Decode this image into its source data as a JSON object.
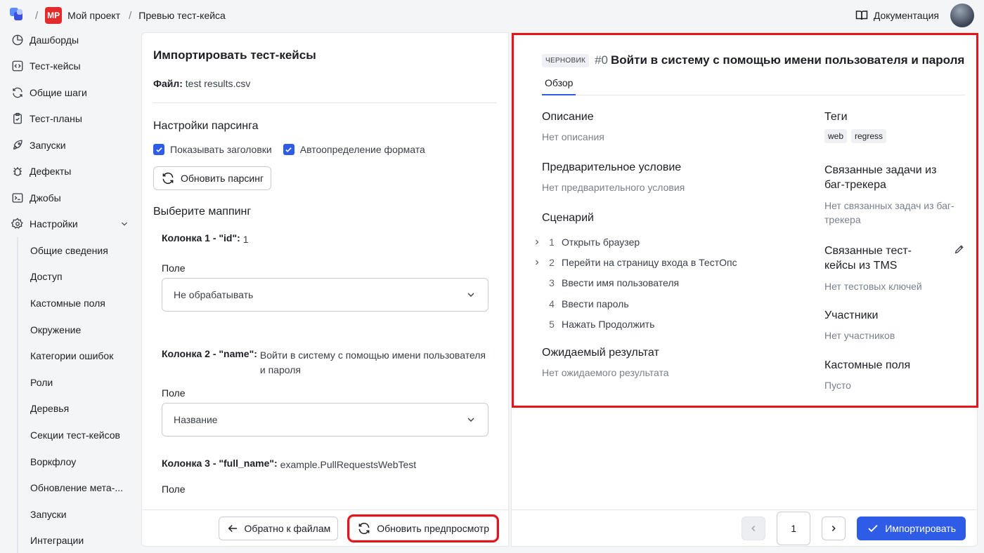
{
  "topbar": {
    "project_badge": "МР",
    "project_name": "Мой проект",
    "page_title": "Превью тест-кейса",
    "docs_label": "Документация"
  },
  "sidebar": {
    "items": [
      {
        "label": "Дашборды",
        "icon": "dashboard-icon"
      },
      {
        "label": "Тест-кейсы",
        "icon": "code-icon"
      },
      {
        "label": "Общие шаги",
        "icon": "refresh-icon"
      },
      {
        "label": "Тест-планы",
        "icon": "clipboard-icon"
      },
      {
        "label": "Запуски",
        "icon": "rocket-icon"
      },
      {
        "label": "Дефекты",
        "icon": "bug-icon"
      },
      {
        "label": "Джобы",
        "icon": "terminal-icon"
      },
      {
        "label": "Настройки",
        "icon": "gear-icon"
      }
    ],
    "settings_sub": [
      "Общие сведения",
      "Доступ",
      "Кастомные поля",
      "Окружение",
      "Категории ошибок",
      "Роли",
      "Деревья",
      "Секции тест-кейсов",
      "Воркфлоу",
      "Обновление мета-...",
      "Запуски",
      "Интеграции"
    ]
  },
  "import": {
    "title": "Импортировать тест-кейсы",
    "file_label": "Файл:",
    "file_name": "test results.csv",
    "parse_settings": "Настройки парсинга",
    "show_headers": "Показывать заголовки",
    "auto_format": "Автоопределение формата",
    "refresh_parse": "Обновить парсинг",
    "mapping_title": "Выберите маппинг",
    "field_label": "Поле",
    "columns": [
      {
        "title": "Колонка 1 - \"id\":",
        "value": "1",
        "field": "Не обрабатывать"
      },
      {
        "title": "Колонка 2 - \"name\":",
        "value": "Войти в систему с помощью имени пользователя и пароля",
        "field": "Название"
      },
      {
        "title": "Колонка 3 - \"full_name\":",
        "value": "example.PullRequestsWebTest",
        "field": ""
      }
    ],
    "back_button": "Обратно к файлам",
    "refresh_preview": "Обновить предпросмотр"
  },
  "preview": {
    "draft": "ЧЕРНОВИК",
    "number": "#0",
    "title": "Войти в систему с помощью имени пользователя и пароля",
    "tab": "Обзор",
    "description_h": "Описание",
    "description_v": "Нет описания",
    "precondition_h": "Предварительное условие",
    "precondition_v": "Нет предварительного условия",
    "scenario_h": "Сценарий",
    "steps": [
      {
        "n": "1",
        "text": "Открыть браузер",
        "expandable": true
      },
      {
        "n": "2",
        "text": "Перейти на страницу входа в ТестОпс",
        "expandable": true
      },
      {
        "n": "3",
        "text": "Ввести имя пользователя",
        "expandable": false
      },
      {
        "n": "4",
        "text": "Ввести пароль",
        "expandable": false
      },
      {
        "n": "5",
        "text": "Нажать Продолжить",
        "expandable": false
      }
    ],
    "expected_h": "Ожидаемый результат",
    "expected_v": "Нет ожидаемого результата",
    "tags_h": "Теги",
    "tags": [
      "web",
      "regress"
    ],
    "bug_h": "Связанные задачи из баг-трекера",
    "bug_v": "Нет связанных задач из баг-трекера",
    "tms_h": "Связанные тест-кейсы из TMS",
    "tms_v": "Нет тестовых ключей",
    "members_h": "Участники",
    "members_v": "Нет участников",
    "custom_h": "Кастомные поля",
    "custom_v": "Пусто"
  },
  "pager": {
    "page": "1",
    "import_button": "Импортировать"
  },
  "colors": {
    "accent": "#2e5ce6",
    "highlight": "#e5141a",
    "badge": "#e32b2b"
  }
}
